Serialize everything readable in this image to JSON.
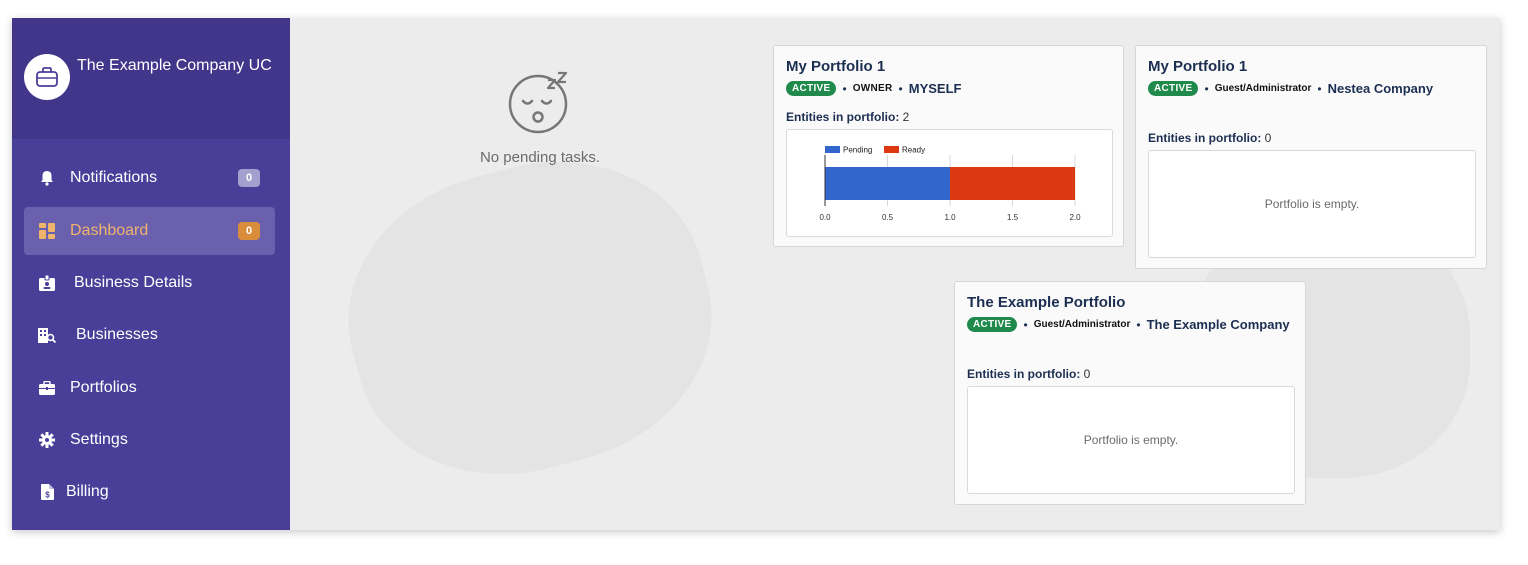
{
  "brand": {
    "name": "The Example Company UC",
    "logo_icon": "briefcase-icon"
  },
  "sidebar": {
    "items": [
      {
        "label": "Notifications",
        "icon": "bell-icon",
        "badge": "0",
        "active": false
      },
      {
        "label": "Dashboard",
        "icon": "dashboard-icon",
        "badge": "0",
        "active": true
      },
      {
        "label": "Business Details",
        "icon": "id-badge-icon",
        "active": false
      },
      {
        "label": "Businesses",
        "icon": "building-search-icon",
        "active": false
      },
      {
        "label": "Portfolios",
        "icon": "briefcase-icon",
        "active": false
      },
      {
        "label": "Settings",
        "icon": "gear-icon",
        "active": false
      },
      {
        "label": "Billing",
        "icon": "invoice-icon",
        "active": false
      }
    ]
  },
  "tasks": {
    "empty_text": "No pending tasks.",
    "icon": "sleeping-face-icon"
  },
  "portfolios": [
    {
      "title": "My Portfolio 1",
      "status": "ACTIVE",
      "role": "OWNER",
      "owner": "MYSELF",
      "entities_label": "Entities in portfolio:",
      "entities_count": "2"
    },
    {
      "title": "My Portfolio 1",
      "status": "ACTIVE",
      "role": "Guest/Administrator",
      "owner": "Nestea Company",
      "entities_label": "Entities in portfolio:",
      "entities_count": "0",
      "empty_text": "Portfolio is empty."
    },
    {
      "title": "The Example Portfolio",
      "status": "ACTIVE",
      "role": "Guest/Administrator",
      "owner": "The Example Company",
      "entities_label": "Entities in portfolio:",
      "entities_count": "0",
      "empty_text": "Portfolio is empty."
    }
  ],
  "colors": {
    "sidebar": "#4a3f98",
    "active_item": "#6a60ad",
    "active_text": "#f0b46c",
    "pending": "#3366cc",
    "ready": "#dc3912",
    "status_green": "#1f8a4c"
  },
  "chart_data": {
    "type": "bar",
    "orientation": "horizontal",
    "stacked": true,
    "categories": [
      ""
    ],
    "series": [
      {
        "name": "Pending",
        "values": [
          1
        ],
        "color": "#3366cc"
      },
      {
        "name": "Ready",
        "values": [
          1
        ],
        "color": "#dc3912"
      }
    ],
    "xlim": [
      0,
      2
    ],
    "xticks": [
      "0.0",
      "0.5",
      "1.0",
      "1.5",
      "2.0"
    ],
    "legend": "top-left",
    "grid": true
  }
}
